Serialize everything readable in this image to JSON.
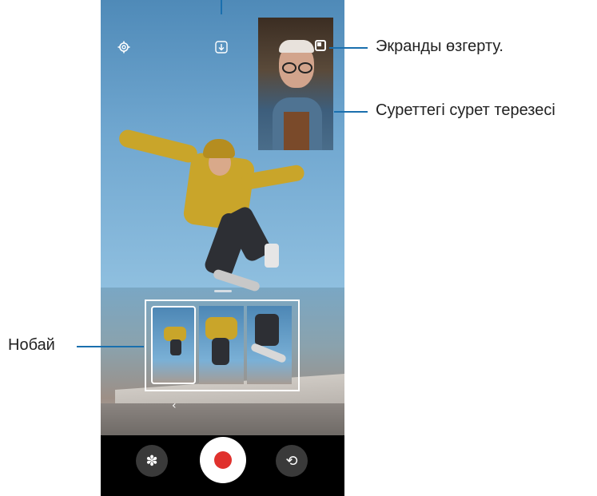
{
  "callouts": {
    "switch_screen": "Экранды өзгерту.",
    "pip_window": "Суреттегі сурет терезесі",
    "single_take": "Нобай"
  },
  "camera_ui": {
    "settings_icon": "gear-icon",
    "save_icon": "download-icon",
    "back_chevron": "‹",
    "effects_glyph": "✽",
    "flip_glyph": "⟲"
  },
  "colors": {
    "callout_line": "#1a6fae",
    "record_red": "#e0312d"
  }
}
